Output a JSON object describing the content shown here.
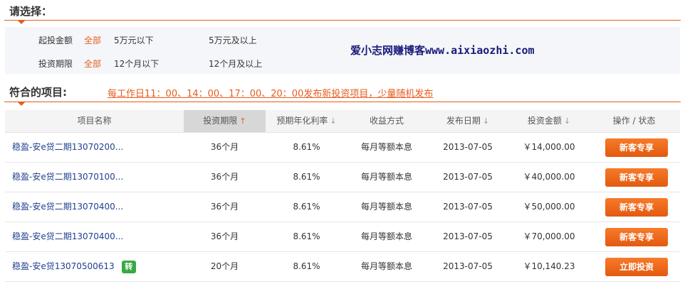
{
  "selection": {
    "title": "请选择：",
    "filters": [
      {
        "label": "起投金额",
        "all": "全部",
        "opt1": "5万元以下",
        "opt2": "5万元及以上"
      },
      {
        "label": "投资期限",
        "all": "全部",
        "opt1": "12个月以下",
        "opt2": "12个月及以上"
      }
    ]
  },
  "watermark": "爱小志网赚博客www.aixiaozhi.com",
  "projects": {
    "title": "符合的项目:",
    "notice": "每工作日11：00、14：00、17：00、20：00发布新投资项目，少量随机发布"
  },
  "table": {
    "headers": {
      "name": "项目名称",
      "term": "投资期限",
      "rate": "预期年化利率",
      "method": "收益方式",
      "date": "发布日期",
      "amount": "投资金额",
      "action": "操作 / 状态"
    },
    "sort_icons": {
      "active": "↑",
      "default": "↓"
    },
    "rows": [
      {
        "name": "稳盈-安e贷二期13070200...",
        "term": "36个月",
        "rate": "8.61%",
        "method": "每月等额本息",
        "date": "2013-07-05",
        "amount": "￥14,000.00",
        "action": "新客专享",
        "badge": ""
      },
      {
        "name": "稳盈-安e贷二期13070100...",
        "term": "36个月",
        "rate": "8.61%",
        "method": "每月等额本息",
        "date": "2013-07-05",
        "amount": "￥40,000.00",
        "action": "新客专享",
        "badge": ""
      },
      {
        "name": "稳盈-安e贷二期13070400...",
        "term": "36个月",
        "rate": "8.61%",
        "method": "每月等额本息",
        "date": "2013-07-05",
        "amount": "￥50,000.00",
        "action": "新客专享",
        "badge": ""
      },
      {
        "name": "稳盈-安e贷二期13070400...",
        "term": "36个月",
        "rate": "8.61%",
        "method": "每月等额本息",
        "date": "2013-07-05",
        "amount": "￥70,000.00",
        "action": "新客专享",
        "badge": ""
      },
      {
        "name": "稳盈-安e贷13070500613",
        "term": "20个月",
        "rate": "8.61%",
        "method": "每月等额本息",
        "date": "2013-07-05",
        "amount": "￥10,140.23",
        "action": "立即投资",
        "badge": "转"
      }
    ]
  },
  "colors": {
    "accent": "#e65c1c",
    "link": "#1f3f8f",
    "badge": "#3ba844"
  }
}
